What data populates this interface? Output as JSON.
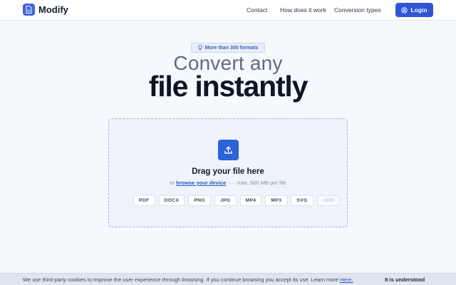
{
  "header": {
    "brand": "Modify",
    "nav": [
      "Contact",
      "How does it work",
      "Conversion types"
    ],
    "login_label": "Login"
  },
  "hero": {
    "badge": "More than 300 formats",
    "headline_light": "Convert any",
    "headline_bold": "file instantly"
  },
  "dropzone": {
    "title": "Drag your file here",
    "prefix": "or",
    "browse_link": "browse your device",
    "separator": "—",
    "limit": "max. 500 MB per file",
    "formats": [
      "PDF",
      "DOCX",
      "PNG",
      "JPG",
      "MP4",
      "MP3",
      "SVG"
    ],
    "more_formats": "+300"
  },
  "cookie": {
    "text": "We use third-party cookies to improve the user experience through browsing. If you continue browsing you accept its use. Learn more",
    "link": "Here.",
    "accept": "It is understood"
  },
  "colors": {
    "accent": "#2f55d4",
    "background": "#f5f8fc",
    "dropzone_border": "#9ab7e6"
  }
}
